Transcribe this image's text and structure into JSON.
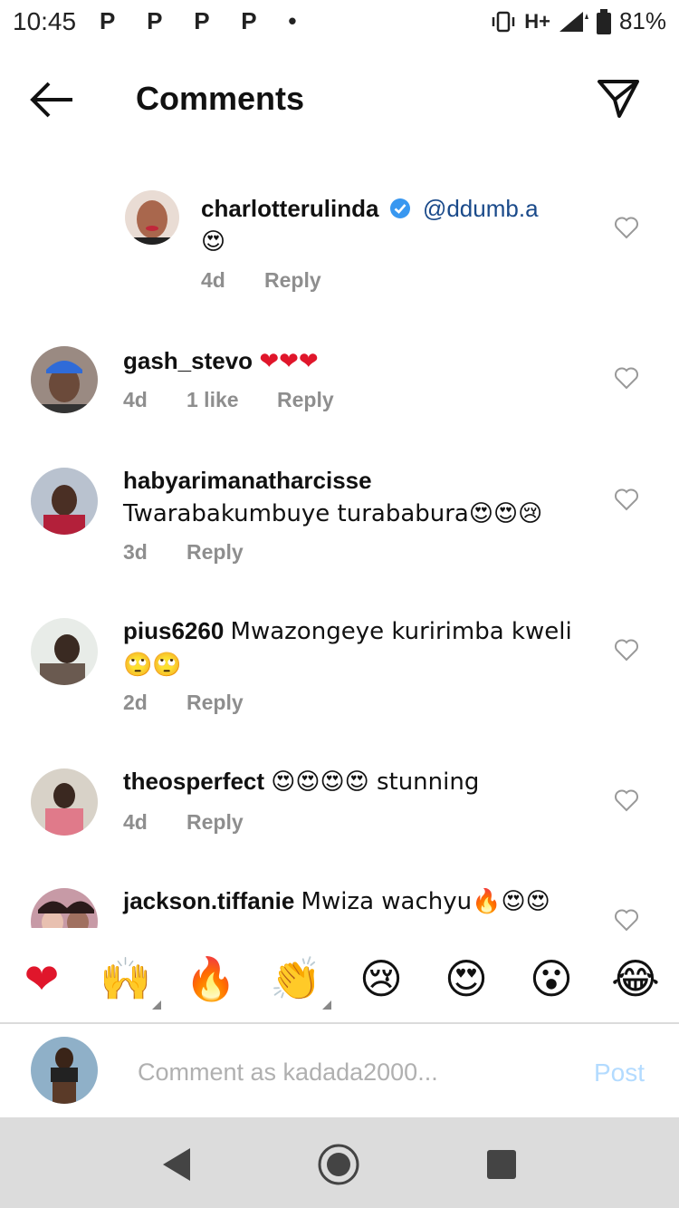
{
  "status_bar": {
    "time": "10:45",
    "notification_icons": "P P P P •",
    "network": "H+",
    "battery": "81%"
  },
  "header": {
    "title": "Comments",
    "back_icon": "arrow-left-icon",
    "share_icon": "paper-plane-icon"
  },
  "comments": [
    {
      "username": "charlotterulinda",
      "verified": true,
      "mention": "@ddumb.a",
      "text": "😍",
      "age": "4d",
      "likes": "",
      "reply": "Reply"
    },
    {
      "username": "gash_stevo",
      "text": "❤❤❤",
      "age": "4d",
      "likes": "1 like",
      "reply": "Reply"
    },
    {
      "username": "habyarimanatharcisse",
      "text": "Twarabakumbuye turababura😍😍😢",
      "age": "3d",
      "likes": "",
      "reply": "Reply"
    },
    {
      "username": "pius6260",
      "text": "Mwazongeye kuririmba kweli 🙄🙄",
      "age": "2d",
      "likes": "",
      "reply": "Reply"
    },
    {
      "username": "theosperfect",
      "text": "😍😍😍😍 stunning",
      "age": "4d",
      "likes": "",
      "reply": "Reply"
    },
    {
      "username": "jackson.tiffanie",
      "text": "Mwiza wachyu🔥😍😍",
      "age": "",
      "likes": "",
      "reply": ""
    }
  ],
  "emoji_bar": [
    "❤",
    "🙌",
    "🔥",
    "👏",
    "😢",
    "😍",
    "😮",
    "😂"
  ],
  "composer": {
    "placeholder": "Comment as kadada2000...",
    "post_label": "Post"
  },
  "colors": {
    "accent_blue": "#3897f0",
    "post_disabled": "#b3dbff",
    "meta_gray": "#8e8e8e",
    "heart_red": "#e0162b"
  }
}
